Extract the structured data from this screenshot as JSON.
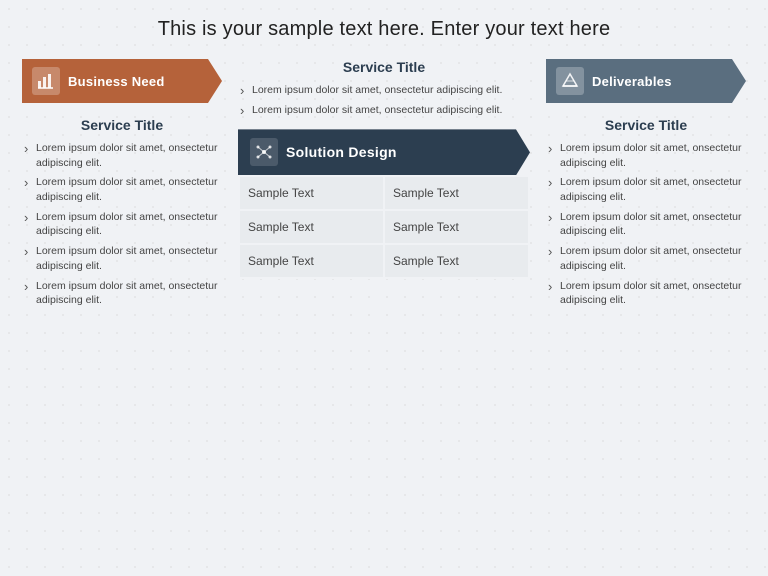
{
  "header": {
    "title": "This is your sample text here. Enter your text here"
  },
  "left_column": {
    "banner_label": "Business Need",
    "service_title": "Service Title",
    "bullets": [
      "Lorem ipsum dolor sit amet, onsectetur adipiscing elit.",
      "Lorem ipsum dolor sit amet, onsectetur adipiscing elit.",
      "Lorem ipsum dolor sit amet, onsectetur adipiscing elit.",
      "Lorem ipsum dolor sit amet, onsectetur adipiscing elit.",
      "Lorem ipsum dolor sit amet, onsectetur adipiscing elit."
    ]
  },
  "center_column": {
    "top_service_title": "Service Title",
    "top_bullets": [
      "Lorem ipsum dolor sit amet, onsectetur adipiscing elit.",
      "Lorem ipsum dolor sit amet, onsectetur adipiscing elit."
    ],
    "solution_banner_label": "Solution Design",
    "grid": [
      [
        "Sample Text",
        "Sample Text"
      ],
      [
        "Sample Text",
        "Sample Text"
      ],
      [
        "Sample Text",
        "Sample Text"
      ]
    ]
  },
  "right_column": {
    "banner_label": "Deliverables",
    "service_title": "Service Title",
    "bullets": [
      "Lorem ipsum dolor sit amet, onsectetur adipiscing elit.",
      "Lorem ipsum dolor sit amet, onsectetur adipiscing elit.",
      "Lorem ipsum dolor sit amet, onsectetur adipiscing elit.",
      "Lorem ipsum dolor sit amet, onsectetur adipiscing elit.",
      "Lorem ipsum dolor sit amet, onsectetur adipiscing elit."
    ]
  },
  "icons": {
    "business_need": "📊",
    "deliverables": "🏛",
    "solution_design": "🔗"
  }
}
